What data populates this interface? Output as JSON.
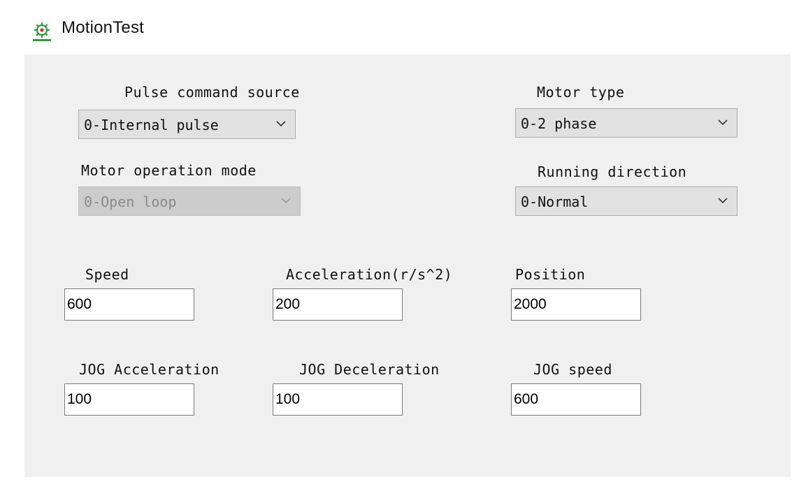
{
  "window": {
    "title": "MotionTest",
    "icon": "gear-settings-icon"
  },
  "pulse_command_source": {
    "label": "Pulse command source",
    "value": "0-Internal pulse"
  },
  "motor_type": {
    "label": "Motor type",
    "value": "0-2 phase"
  },
  "motor_operation_mode": {
    "label": "Motor operation mode",
    "value": "0-Open loop",
    "enabled": false
  },
  "running_direction": {
    "label": "Running direction",
    "value": "0-Normal"
  },
  "speed": {
    "label": "Speed",
    "value": "600"
  },
  "acceleration": {
    "label": "Acceleration(r/s^2)",
    "value": "200"
  },
  "position": {
    "label": "Position",
    "value": "2000"
  },
  "jog_acceleration": {
    "label": "JOG Acceleration",
    "value": "100"
  },
  "jog_deceleration": {
    "label": "JOG Deceleration",
    "value": "100"
  },
  "jog_speed": {
    "label": "JOG speed",
    "value": "600"
  },
  "colors": {
    "panel_bg": "#f0f0f0",
    "combo_bg": "#e1e1e1",
    "combo_disabled_bg": "#cccccc",
    "icon_accent": "#2e9b3a"
  }
}
